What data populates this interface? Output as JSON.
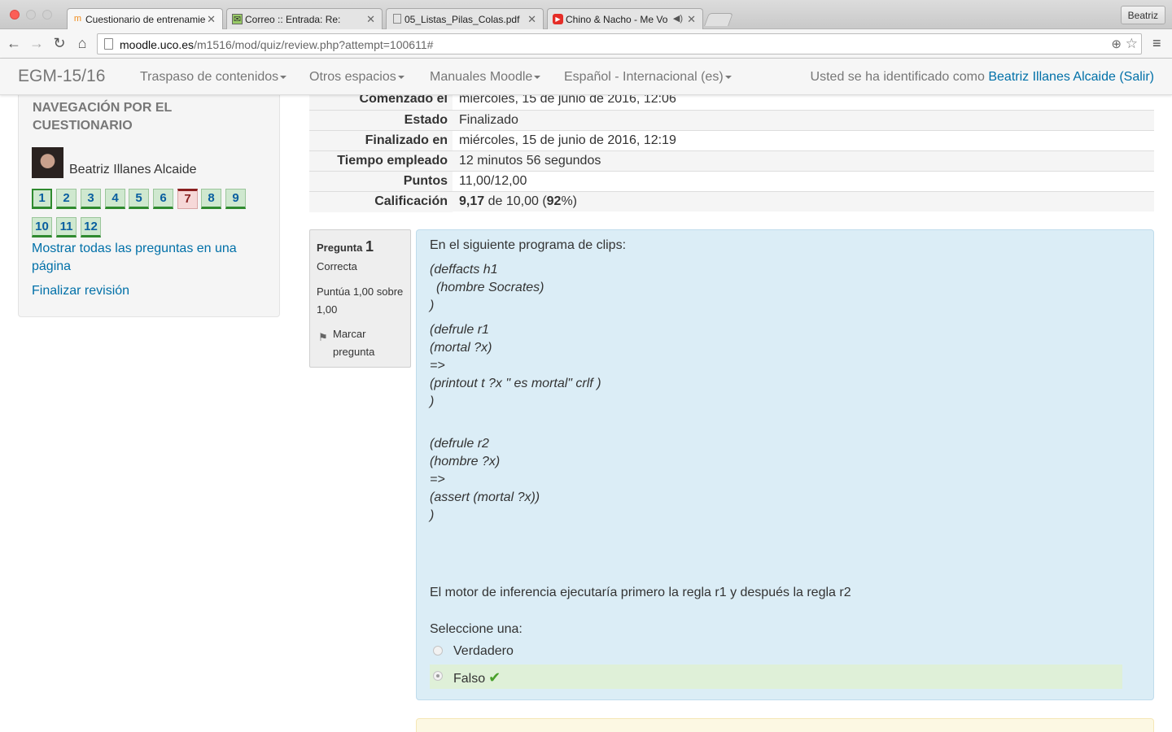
{
  "browser": {
    "tabs": [
      {
        "title": "Cuestionario de entrenamie",
        "icon": "moodle-icon"
      },
      {
        "title": "Correo :: Entrada: Re:",
        "icon": "mail-icon"
      },
      {
        "title": "05_Listas_Pilas_Colas.pdf",
        "icon": "page-icon"
      },
      {
        "title": "Chino & Nacho - Me Vo",
        "icon": "youtube-icon"
      }
    ],
    "profile": "Beatriz",
    "url_host": "moodle.uco.es",
    "url_path": "/m1516/mod/quiz/review.php?attempt=100611#"
  },
  "navbar": {
    "brand": "EGM-15/16",
    "menus": [
      "Traspaso de contenidos",
      "Otros espacios",
      "Manuales Moodle",
      "Español - Internacional (es)"
    ],
    "login_prefix": "Usted se ha identificado como ",
    "user": "Beatriz Illanes Alcaide",
    "logout": "(Salir)"
  },
  "quiz_nav": {
    "title": "NAVEGACIÓN POR EL CUESTIONARIO",
    "user": "Beatriz Illanes Alcaide",
    "questions": [
      "1",
      "2",
      "3",
      "4",
      "5",
      "6",
      "7",
      "8",
      "9",
      "10",
      "11",
      "12"
    ],
    "show_all": "Mostrar todas las preguntas en una página",
    "finish": "Finalizar revisión"
  },
  "summary": {
    "rows": [
      {
        "label": "Comenzado el",
        "value": "miércoles, 15 de junio de 2016, 12:06"
      },
      {
        "label": "Estado",
        "value": "Finalizado"
      },
      {
        "label": "Finalizado en",
        "value": "miércoles, 15 de junio de 2016, 12:19"
      },
      {
        "label": "Tiempo empleado",
        "value": "12 minutos 56 segundos"
      },
      {
        "label": "Puntos",
        "value": "11,00/12,00"
      }
    ],
    "grade_label": "Calificación",
    "grade_value": "9,17",
    "grade_middle": " de 10,00 (",
    "grade_percent": "92",
    "grade_end": "%)"
  },
  "question": {
    "label": "Pregunta",
    "number": "1",
    "state": "Correcta",
    "grade": "Puntúa 1,00 sobre 1,00",
    "flag": "Marcar pregunta",
    "intro": "En el siguiente programa de clips:",
    "code": {
      "l1": "(deffacts h1",
      "l2": "(hombre Socrates)",
      "l3": ")",
      "l4": "(defrule r1",
      "l5": "(mortal ?x)",
      "l6": "=>",
      "l7": "(printout t ?x \" es mortal\" crlf )",
      "l8": ")",
      "l9": "(defrule r2",
      "l10": "(hombre ?x)",
      "l11": "=>",
      "l12": "(assert (mortal ?x))",
      "l13": ")"
    },
    "statement": "El motor de inferencia ejecutaría primero la regla r1 y después la regla r2",
    "prompt": "Seleccione una:",
    "options": [
      "Verdadero",
      "Falso"
    ],
    "selected_option": "Falso"
  }
}
